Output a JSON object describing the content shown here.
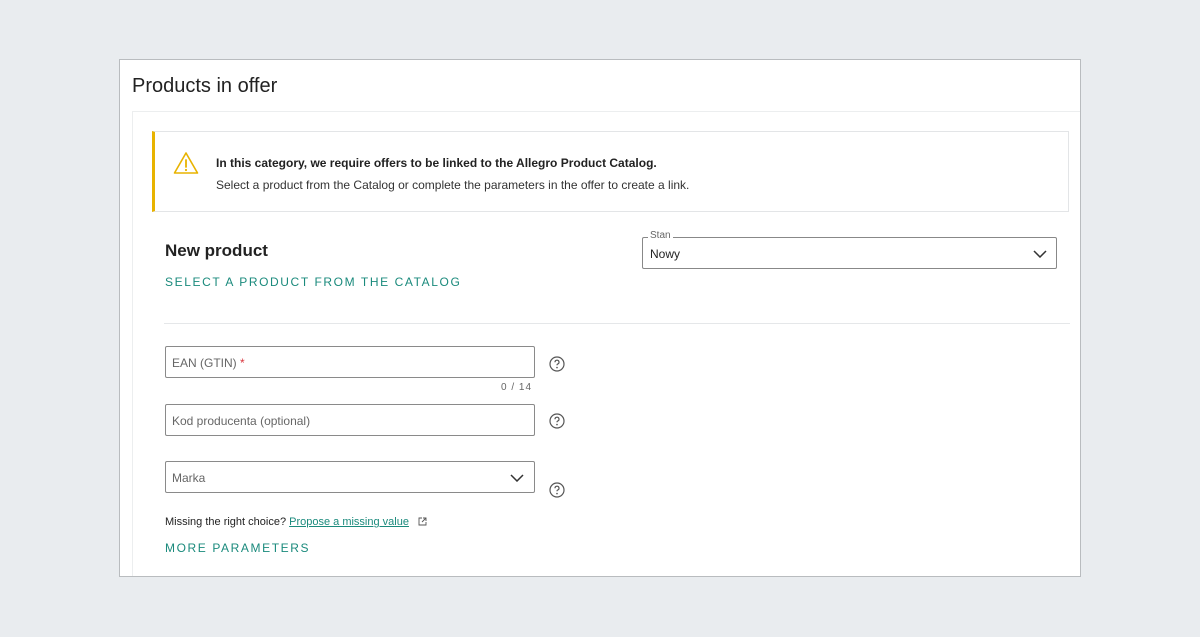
{
  "header": {
    "title": "Products in offer"
  },
  "notice": {
    "title": "In this category, we require offers to be linked to the Allegro Product Catalog.",
    "text": "Select a product from the Catalog or complete the parameters in the offer to create a link.",
    "icon": "warning-icon",
    "accent": "#e8b300"
  },
  "product": {
    "section_title": "New product",
    "catalog_link": "SELECT A PRODUCT FROM THE CATALOG",
    "stan": {
      "label": "Stan",
      "value": "Nowy"
    }
  },
  "fields": {
    "ean": {
      "placeholder": "EAN (GTIN)",
      "required_mark": "*",
      "counter": "0 / 14"
    },
    "producer_code": {
      "placeholder": "Kod producenta (optional)"
    },
    "brand": {
      "placeholder": "Marka"
    }
  },
  "missing": {
    "prefix": "Missing the right choice?",
    "link": "Propose a missing value"
  },
  "more_params": "MORE PARAMETERS",
  "colors": {
    "link": "#1a8a7c",
    "background": "#e9ecef"
  }
}
